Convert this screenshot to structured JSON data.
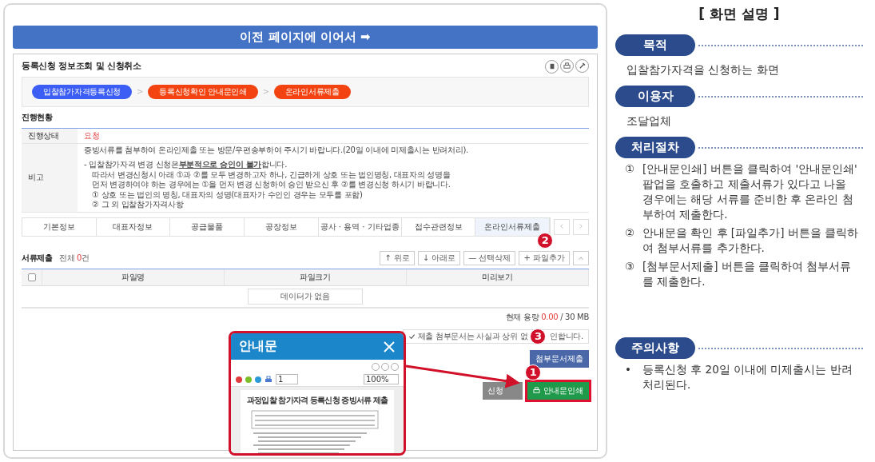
{
  "banner": "이전 페이지에 이어서 ➡",
  "page": {
    "title": "등록신청 정보조회 및 신청취소",
    "steps": [
      {
        "label": "입찰참가자격등록신청",
        "color": "#3d5ef5"
      },
      {
        "label": "등록신청확인 안내문인쇄",
        "color": "#f24311"
      },
      {
        "label": "온라인서류제출",
        "color": "#f24311"
      }
    ],
    "step_separator": ">"
  },
  "progress": {
    "heading": "진행현황",
    "status": {
      "label": "진행상태",
      "value": "요청"
    },
    "remarks": {
      "label": "비고",
      "lines": [
        "증빙서류를 첨부하여 온라인제출 또는 방문/우편송부하여 주시기 바랍니다.(20일 이내에 미제출시는 반려처리).",
        "- 입찰참가자격 변경 신청은**부분적으로 승인이 불가**합니다.",
        "따라서 변경신청시 아래 ①과 ②를 모두 변경하고자 하나, 긴급하게 상호 또는 법인명칭, 대표자의 성명을",
        "먼저 변경하여야 하는 경우에는 ①을 먼저 변경 신청하여 승인 받으신 후 ②를 변경신청 하시기 바랍니다.",
        "① 상호 또는 법인의 명칭, 대표자의 성명(대표자가 수인인 경우는 모두를 포함)",
        "② 그 외 입찰참가자격사항"
      ]
    }
  },
  "tabs": [
    {
      "label": "기본정보",
      "selected": false
    },
    {
      "label": "대표자정보",
      "selected": false
    },
    {
      "label": "공급물품",
      "selected": false
    },
    {
      "label": "공장정보",
      "selected": false
    },
    {
      "label": "공사 · 용역 · 기타업종",
      "selected": false
    },
    {
      "label": "접수관련정보",
      "selected": false
    },
    {
      "label": "온라인서류제출",
      "selected": true
    }
  ],
  "documents": {
    "title": "서류제출",
    "count_prefix": "전체",
    "count": "0",
    "count_suffix": "건",
    "toolbar": [
      "↑ 위로",
      "↓ 아래로",
      "— 선택삭제",
      "+ 파일추가"
    ],
    "select_all_checked": false,
    "columns": [
      "파일명",
      "파일크기",
      "미리보기"
    ],
    "empty_message": "데이터가 없음",
    "capacity_label": "현재 용량",
    "capacity_used": "0.00",
    "capacity_total": "/ 30 MB",
    "confirmed": true,
    "notice_before": "제출 첨부문서는 사실과 상위 없",
    "notice_after": "인합니다.",
    "submit_button": "첨부문서제출",
    "apply_button": "신청",
    "print_button": "안내문인쇄"
  },
  "badges": [
    "1",
    "2",
    "3"
  ],
  "popup": {
    "title": "안내문",
    "page_field": "1",
    "zoom": "100%",
    "document_title": "과정입찰 참가자격 등록신청 증빙서류 제출"
  },
  "explanation": {
    "title": "[ 화면 설명 ]",
    "sections": [
      {
        "heading": "목적",
        "kind": "text",
        "items": [
          "입찰참가자격을 신청하는 화면"
        ]
      },
      {
        "heading": "이용자",
        "kind": "text",
        "items": [
          "조달업체"
        ]
      },
      {
        "heading": "처리절차",
        "kind": "numbered",
        "items": [
          {
            "mark": "①",
            "text": "[안내문인쇄] 버튼을 클릭하여 '안내문인쇄' 팝업을 호출하고 제출서류가 있다고 나올 경우에는 해당 서류를 준비한 후 온라인 첨부하여 제출한다."
          },
          {
            "mark": "②",
            "text": "안내문을 확인 후 [파일추가] 버튼을 클릭하여 첨부서류를 추가한다."
          },
          {
            "mark": "③",
            "text": "[첨부문서제출] 버튼을 클릭하여 첨부서류를 제출한다."
          }
        ]
      },
      {
        "heading": "주의사항",
        "kind": "bullet",
        "items": [
          {
            "mark": "•",
            "text": "등록신청 후 20일 이내에 미제출시는 반려 처리된다."
          }
        ]
      }
    ]
  }
}
